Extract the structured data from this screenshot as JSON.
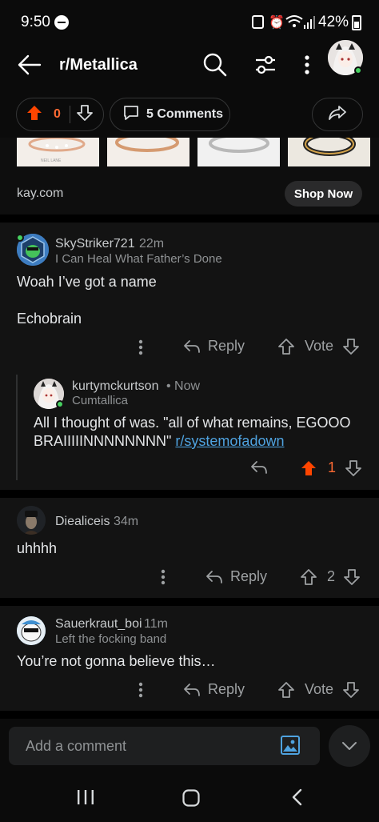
{
  "status": {
    "time": "9:50",
    "battery": "42%"
  },
  "header": {
    "title": "r/Metallica"
  },
  "post_actions": {
    "score": "0",
    "comments_label": "5 Comments"
  },
  "ad": {
    "domain": "kay.com",
    "cta": "Shop Now",
    "ring_brand": "NEIL LANE"
  },
  "comments": [
    {
      "user": "SkyStriker721",
      "time": "22m",
      "flair": "I Can Heal What Father’s Done",
      "lines": [
        "Woah I’ve got a name",
        "Echobrain"
      ],
      "reply_label": "Reply",
      "vote_label": "Vote"
    },
    {
      "user": "kurtymckurtson",
      "time": "• Now",
      "flair": "Cumtallica",
      "text": "All I thought of was. \"all of what remains, EGOOO BRAIIIIINNNNNNNN\"",
      "link": "r/systemofadown",
      "score": "1"
    },
    {
      "user": "Diealiceis",
      "time": "34m",
      "text": "uhhhh",
      "reply_label": "Reply",
      "score": "2"
    },
    {
      "user": "Sauerkraut_boi",
      "time": "11m",
      "flair": "Left the focking band",
      "text": "You’re not gonna believe this…",
      "reply_label": "Reply",
      "vote_label": "Vote"
    }
  ],
  "composer": {
    "placeholder": "Add a comment"
  },
  "colors": {
    "upvote_active": "#ff4500",
    "link": "#4fa3e0",
    "online": "#46d160"
  }
}
